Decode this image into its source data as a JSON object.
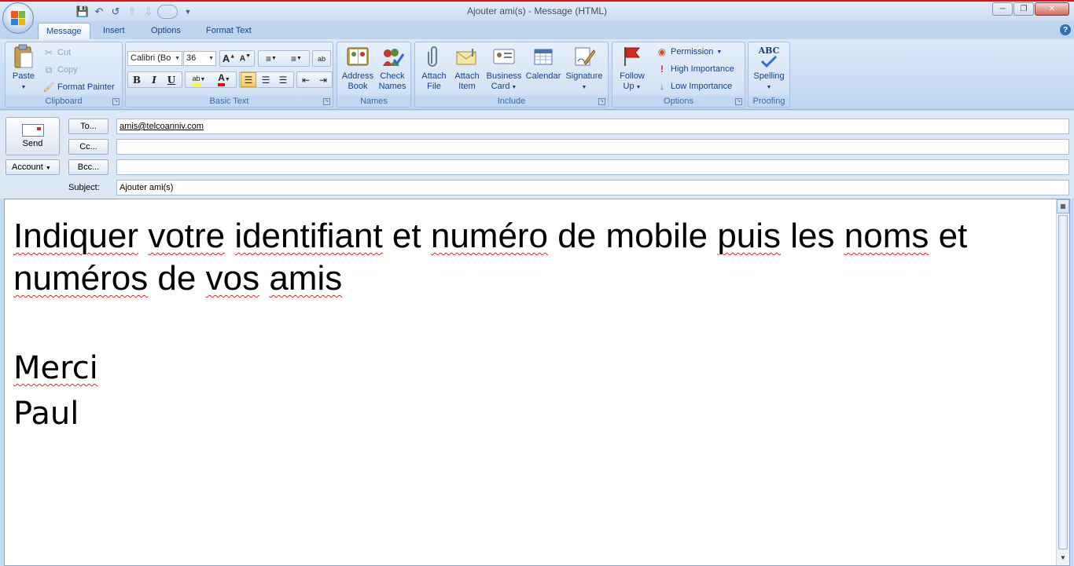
{
  "window": {
    "title": "Ajouter ami(s) - Message (HTML)"
  },
  "quick_access": {
    "icons": [
      "save-icon",
      "undo-icon",
      "redo-icon",
      "previous-item-icon",
      "next-item-icon",
      "customize-qat-icon"
    ]
  },
  "tabs": [
    "Message",
    "Insert",
    "Options",
    "Format Text"
  ],
  "active_tab": "Message",
  "ribbon": {
    "clipboard": {
      "label": "Clipboard",
      "paste": "Paste",
      "cut": "Cut",
      "copy": "Copy",
      "format_painter": "Format Painter"
    },
    "basic_text": {
      "label": "Basic Text",
      "font": "Calibri (Bo",
      "size": "36",
      "bold": "B",
      "italic": "I",
      "underline": "U",
      "highlight_color": "#ffff00",
      "font_color": "#ff0000"
    },
    "names": {
      "label": "Names",
      "address_book": [
        "Address",
        "Book"
      ],
      "check_names": [
        "Check",
        "Names"
      ]
    },
    "include": {
      "label": "Include",
      "attach_file": [
        "Attach",
        "File"
      ],
      "attach_item": [
        "Attach",
        "Item"
      ],
      "business_card": [
        "Business",
        "Card"
      ],
      "calendar": "Calendar",
      "signature": "Signature"
    },
    "options": {
      "label": "Options",
      "follow_up": [
        "Follow",
        "Up"
      ],
      "permission": "Permission",
      "high_importance": "High Importance",
      "low_importance": "Low Importance"
    },
    "proofing": {
      "label": "Proofing",
      "spelling": "Spelling",
      "abc": "ABC"
    }
  },
  "header": {
    "send": "Send",
    "account": "Account",
    "to_button": "To...",
    "cc_button": "Cc...",
    "bcc_button": "Bcc...",
    "subject_label": "Subject:",
    "to_value": "amis@telcoanniv.com",
    "cc_value": "",
    "bcc_value": "",
    "subject_value": "Ajouter ami(s)"
  },
  "body": {
    "line1": "Indiquer votre identifiant et numéro de mobile puis les noms et numéros de vos amis",
    "line2": "Merci",
    "line3": "Paul"
  },
  "colors": {
    "title_border": "#d21818",
    "ribbon_bg": "#c7dbf3",
    "active_button": "#f9c85f"
  }
}
